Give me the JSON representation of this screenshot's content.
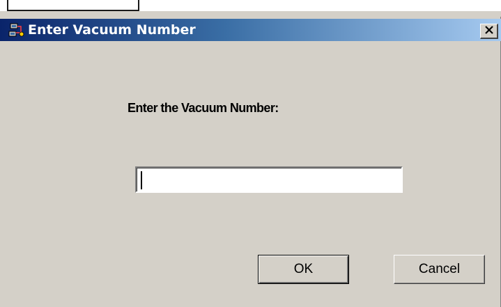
{
  "window": {
    "title": "Enter Vacuum Number",
    "title_icon": "computer-network-icon",
    "close_glyph": "✕"
  },
  "dialog": {
    "prompt": "Enter the Vacuum Number:",
    "input": {
      "value": "",
      "placeholder": ""
    },
    "buttons": {
      "ok_label": "OK",
      "cancel_label": "Cancel"
    }
  },
  "colors": {
    "titlebar_start": "#0a246a",
    "titlebar_end": "#a6caf0",
    "dialog_background": "#d4d0c8"
  }
}
